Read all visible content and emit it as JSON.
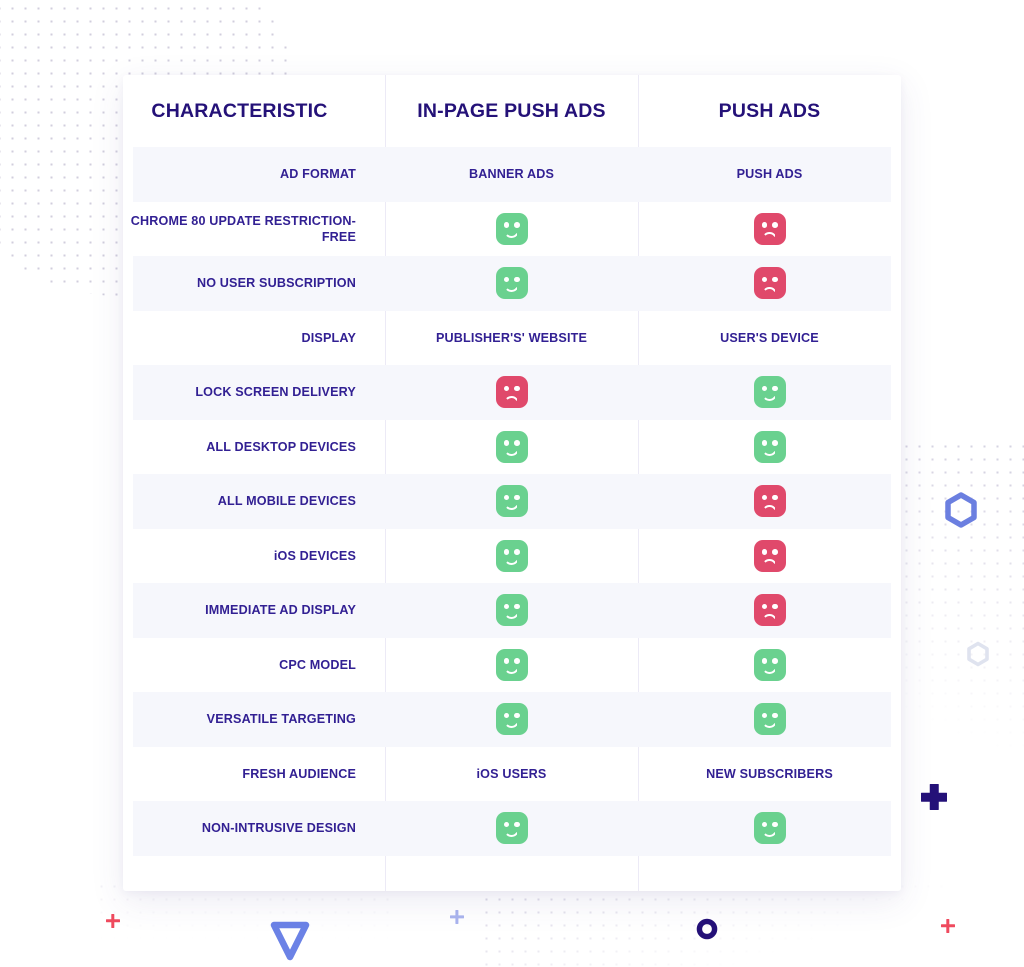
{
  "table": {
    "headers": [
      "CHARACTERISTIC",
      "IN-PAGE PUSH ADS",
      "PUSH ADS"
    ],
    "rows": [
      {
        "label": "AD FORMAT",
        "inpage": "BANNER ADS",
        "push": "PUSH ADS",
        "type": "text",
        "striped": true
      },
      {
        "label": "CHROME 80 UPDATE RESTRICTION-FREE",
        "inpage": "good",
        "push": "bad",
        "type": "icon",
        "striped": false
      },
      {
        "label": "NO USER SUBSCRIPTION",
        "inpage": "good",
        "push": "bad",
        "type": "icon",
        "striped": true
      },
      {
        "label": "DISPLAY",
        "inpage": "PUBLISHER'S' WEBSITE",
        "push": "USER'S DEVICE",
        "type": "text",
        "striped": false
      },
      {
        "label": "LOCK SCREEN DELIVERY",
        "inpage": "bad",
        "push": "good",
        "type": "icon",
        "striped": true
      },
      {
        "label": "ALL DESKTOP DEVICES",
        "inpage": "good",
        "push": "good",
        "type": "icon",
        "striped": false
      },
      {
        "label": "ALL MOBILE DEVICES",
        "inpage": "good",
        "push": "bad",
        "type": "icon",
        "striped": true
      },
      {
        "label": "iOS DEVICES",
        "inpage": "good",
        "push": "bad",
        "type": "icon",
        "striped": false
      },
      {
        "label": "IMMEDIATE AD DISPLAY",
        "inpage": "good",
        "push": "bad",
        "type": "icon",
        "striped": true
      },
      {
        "label": "CPC MODEL",
        "inpage": "good",
        "push": "good",
        "type": "icon",
        "striped": false
      },
      {
        "label": "VERSATILE TARGETING",
        "inpage": "good",
        "push": "good",
        "type": "icon",
        "striped": true
      },
      {
        "label": "FRESH AUDIENCE",
        "inpage": "iOS USERS",
        "push": "NEW SUBSCRIBERS",
        "type": "text",
        "striped": false
      },
      {
        "label": "NON-INTRUSIVE DESIGN",
        "inpage": "good",
        "push": "good",
        "type": "icon",
        "striped": true
      }
    ]
  },
  "icons": {
    "good": "smiley-happy-icon",
    "bad": "smiley-sad-icon"
  },
  "colors": {
    "heading": "#241178",
    "body_text": "#322093",
    "positive": "#6ad18f",
    "negative": "#e0496b",
    "stripe": "#f6f7fc",
    "card": "#ffffff",
    "deco_blue": "#6b7fe0",
    "deco_navy": "#241178",
    "deco_red": "#ef4a5e",
    "deco_lilac": "#aab4ee",
    "deco_gray": "#dfe3ef"
  },
  "decorations": [
    {
      "name": "dotted-circle-pattern",
      "shape": "dots"
    },
    {
      "name": "hexagon-outline-blue",
      "shape": "hexagon"
    },
    {
      "name": "hexagon-outline-gray",
      "shape": "hexagon"
    },
    {
      "name": "plus-navy",
      "shape": "plus"
    },
    {
      "name": "plus-red-small-right",
      "shape": "plus"
    },
    {
      "name": "plus-red-small-left",
      "shape": "plus"
    },
    {
      "name": "plus-lilac",
      "shape": "plus"
    },
    {
      "name": "triangle-down-blue",
      "shape": "triangle"
    },
    {
      "name": "ring-navy",
      "shape": "ring"
    }
  ]
}
